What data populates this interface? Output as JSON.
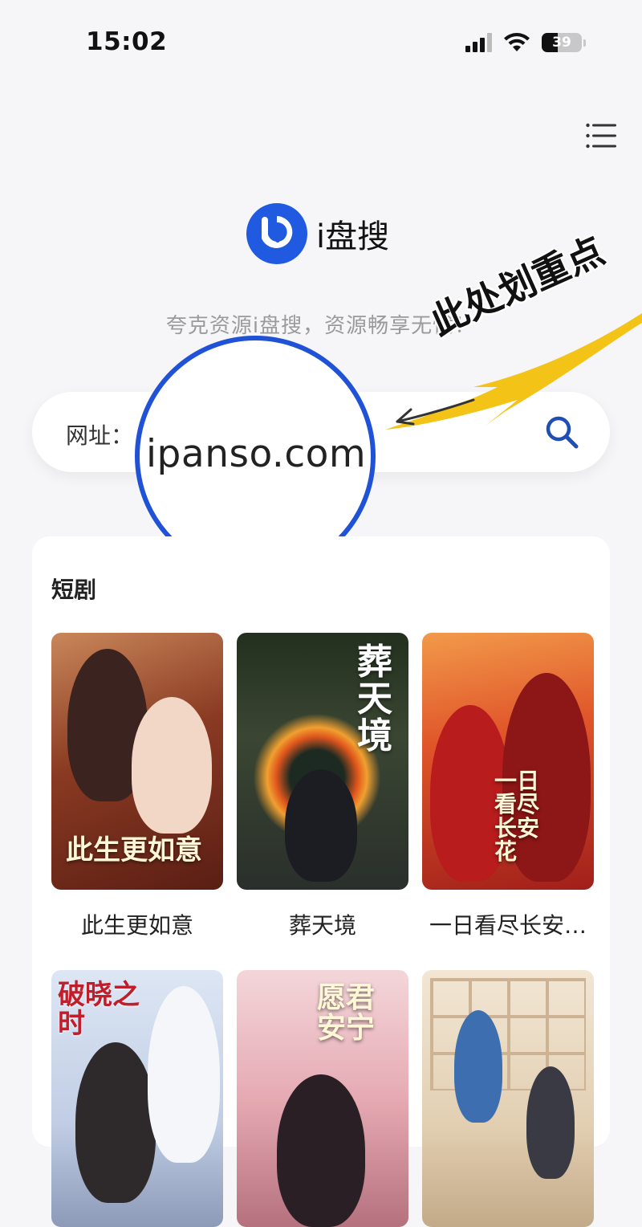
{
  "status_bar": {
    "time": "15:02",
    "battery_percent": "39",
    "icons": [
      "cellular-signal-icon",
      "wifi-icon",
      "battery-icon"
    ]
  },
  "header": {
    "menu_icon": "hamburger-menu-icon"
  },
  "logo": {
    "name": "i盘搜",
    "brand_color": "#1f5ae0"
  },
  "slogan": "夸克资源i盘搜，资源畅享无忧！",
  "search": {
    "label": "网址：",
    "value": "",
    "icon": "search-icon",
    "accent_color": "#1f4fb4"
  },
  "annotation": {
    "url": "ipanso.com",
    "text": "此处划重点",
    "circle_color": "#1f52d6",
    "arrow_color": "#f3c318"
  },
  "section": {
    "title": "短剧",
    "items": [
      {
        "title": "此生更如意",
        "poster_text": "此生更如意"
      },
      {
        "title": "葬天境",
        "poster_text": "葬天境"
      },
      {
        "title": "一日看尽长安…",
        "poster_text": "一日看尽长安花"
      },
      {
        "title": "",
        "poster_text": "破晓之时"
      },
      {
        "title": "",
        "poster_text": "愿君安宁"
      },
      {
        "title": "",
        "poster_text": ""
      }
    ]
  }
}
